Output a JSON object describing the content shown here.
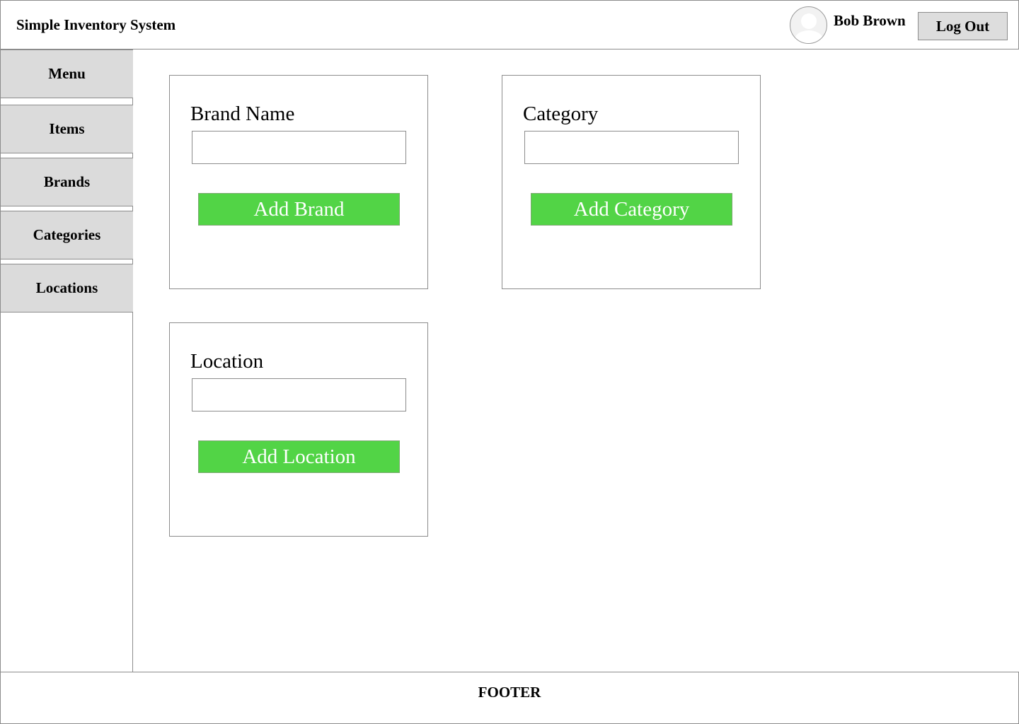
{
  "header": {
    "app_title": "Simple Inventory System",
    "user_name": "Bob Brown",
    "logout_label": "Log Out",
    "avatar_icon": "user-avatar-icon"
  },
  "sidebar": {
    "items": [
      {
        "label": "Menu"
      },
      {
        "label": "Items"
      },
      {
        "label": "Brands"
      },
      {
        "label": "Categories"
      },
      {
        "label": "Locations"
      }
    ]
  },
  "forms": {
    "brand": {
      "label": "Brand Name",
      "value": "",
      "button_label": "Add Brand"
    },
    "category": {
      "label": "Category",
      "value": "",
      "button_label": "Add Category"
    },
    "location": {
      "label": "Location",
      "value": "",
      "button_label": "Add Location"
    }
  },
  "footer": {
    "text": "FOOTER"
  },
  "colors": {
    "add_button": "#52d446",
    "nav_item_bg": "#dbdbdb",
    "border": "#8c8c8c"
  }
}
